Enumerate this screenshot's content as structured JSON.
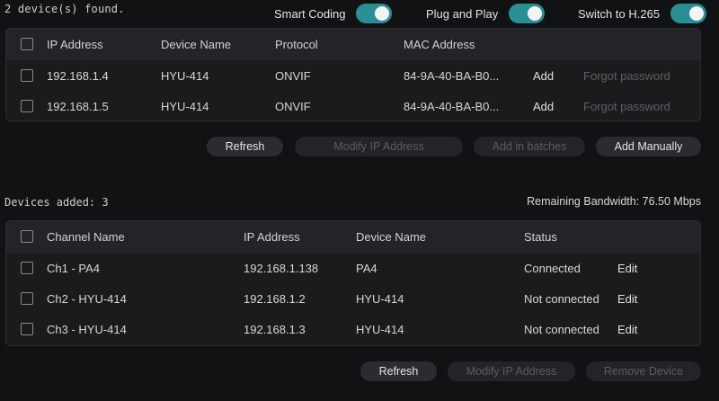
{
  "colors": {
    "accent": "#2a8f95",
    "background": "#111214",
    "panel": "#1a1b1d",
    "header": "#232427"
  },
  "discovery": {
    "found_label": "2 device(s) found.",
    "toggles": [
      {
        "label": "Smart Coding",
        "on": true
      },
      {
        "label": "Plug and Play",
        "on": true
      },
      {
        "label": "Switch to H.265",
        "on": true
      }
    ],
    "columns": [
      "IP Address",
      "Device Name",
      "Protocol",
      "MAC Address"
    ],
    "rows": [
      {
        "ip": "192.168.1.4",
        "name": "HYU-414",
        "protocol": "ONVIF",
        "mac": "84-9A-40-BA-B0...",
        "add": "Add",
        "forgot": "Forgot password"
      },
      {
        "ip": "192.168.1.5",
        "name": "HYU-414",
        "protocol": "ONVIF",
        "mac": "84-9A-40-BA-B0...",
        "add": "Add",
        "forgot": "Forgot password"
      }
    ],
    "buttons": {
      "refresh": "Refresh",
      "modify_ip": "Modify IP Address",
      "add_batches": "Add in batches",
      "add_manually": "Add Manually"
    }
  },
  "added": {
    "title": "Devices added: 3",
    "bandwidth": "Remaining Bandwidth: 76.50 Mbps",
    "columns": [
      "Channel Name",
      "IP Address",
      "Device Name",
      "Status"
    ],
    "rows": [
      {
        "channel": "Ch1 - PA4",
        "ip": "192.168.1.138",
        "name": "PA4",
        "status": "Connected",
        "edit": "Edit"
      },
      {
        "channel": "Ch2 - HYU-414",
        "ip": "192.168.1.2",
        "name": "HYU-414",
        "status": "Not connected",
        "edit": "Edit"
      },
      {
        "channel": "Ch3 - HYU-414",
        "ip": "192.168.1.3",
        "name": "HYU-414",
        "status": "Not connected",
        "edit": "Edit"
      }
    ],
    "buttons": {
      "refresh": "Refresh",
      "modify_ip": "Modify IP Address",
      "remove": "Remove Device"
    }
  }
}
